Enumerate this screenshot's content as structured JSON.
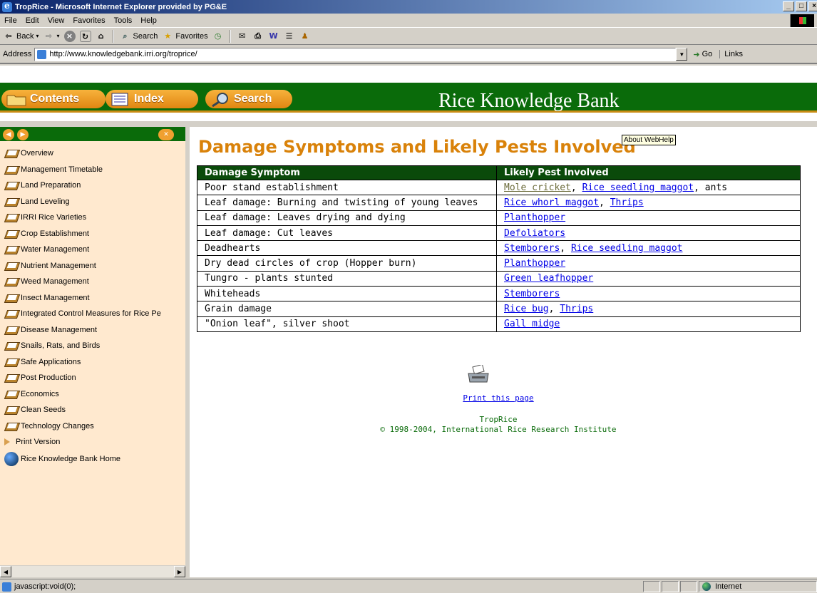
{
  "window": {
    "title": "TropRice - Microsoft Internet Explorer provided by PG&E",
    "minimize": "_",
    "maximize": "□",
    "close": "×"
  },
  "menu": [
    "File",
    "Edit",
    "View",
    "Favorites",
    "Tools",
    "Help"
  ],
  "toolbar": {
    "back": "Back",
    "search": "Search",
    "favorites": "Favorites"
  },
  "address": {
    "label": "Address",
    "url": "http://www.knowledgebank.irri.org/troprice/",
    "go": "Go",
    "links": "Links"
  },
  "banner": {
    "contents": "Contents",
    "index": "Index",
    "search": "Search",
    "brand": "Rice Knowledge Bank",
    "green": "#0a6b0a",
    "orange": "#e08612"
  },
  "toc": {
    "items": [
      "Overview",
      "Management Timetable",
      "Land Preparation",
      "Land Leveling",
      "IRRI Rice Varieties",
      "Crop Establishment",
      "Water Management",
      "Nutrient Management",
      "Weed Management",
      "Insect Management",
      "Integrated Control Measures for Rice Pe",
      "Disease Management",
      "Snails, Rats, and Birds",
      "Safe Applications",
      "Post Production",
      "Economics",
      "Clean Seeds",
      "Technology Changes"
    ],
    "print_version": "Print Version",
    "home": "Rice Knowledge Bank Home"
  },
  "tooltip": "About WebHelp",
  "page": {
    "title": "Damage Symptoms and Likely Pests Involved",
    "table": {
      "headers": [
        "Damage Symptom",
        "Likely Pest Involved"
      ],
      "rows": [
        {
          "symptom": "Poor stand establishment",
          "pests": [
            "Mole cricket",
            "Rice seedling maggot"
          ],
          "extra": ", ants"
        },
        {
          "symptom": "Leaf damage: Burning and twisting of young leaves",
          "pests": [
            "Rice whorl maggot",
            "Thrips"
          ],
          "extra": ""
        },
        {
          "symptom": "Leaf damage: Leaves drying and dying",
          "pests": [
            "Planthopper"
          ],
          "extra": ""
        },
        {
          "symptom": "Leaf damage: Cut leaves",
          "pests": [
            "Defoliators"
          ],
          "extra": ""
        },
        {
          "symptom": "Deadhearts",
          "pests": [
            "Stemborers",
            "Rice seedling maggot"
          ],
          "extra": ""
        },
        {
          "symptom": "Dry dead circles of crop (Hopper burn)",
          "pests": [
            "Planthopper"
          ],
          "extra": ""
        },
        {
          "symptom": "Tungro - plants stunted",
          "pests": [
            "Green leafhopper"
          ],
          "extra": ""
        },
        {
          "symptom": "Whiteheads",
          "pests": [
            "Stemborers"
          ],
          "extra": ""
        },
        {
          "symptom": "Grain damage",
          "pests": [
            "Rice bug",
            "Thrips"
          ],
          "extra": ""
        },
        {
          "symptom": "\"Onion leaf\", silver shoot",
          "pests": [
            "Gall midge"
          ],
          "extra": ""
        }
      ]
    },
    "print_link": "Print this page",
    "footer_line1": "TropRice",
    "footer_line2": "© 1998-2004, International Rice Research Institute"
  },
  "status": {
    "text": "javascript:void(0);",
    "zone": "Internet"
  }
}
